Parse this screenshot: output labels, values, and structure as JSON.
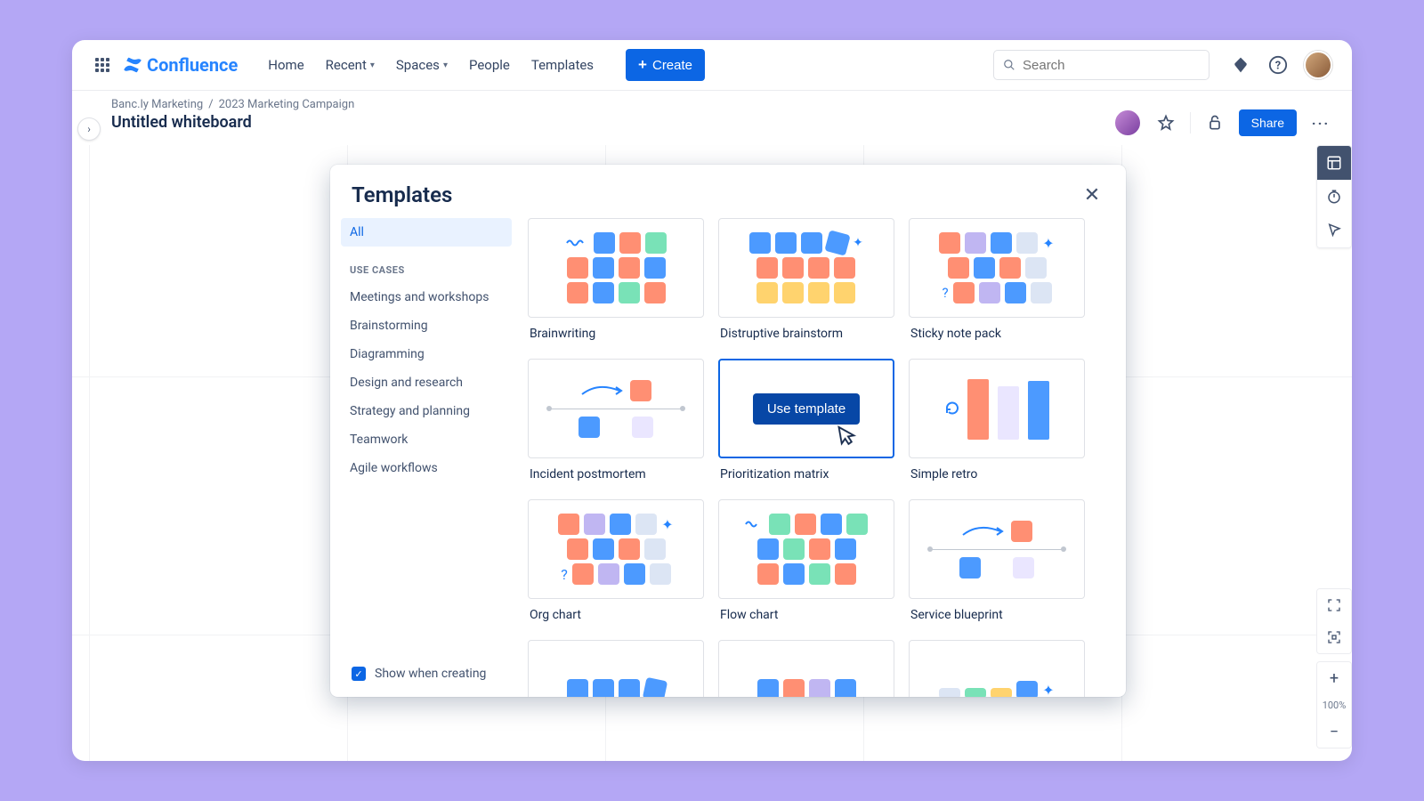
{
  "app": {
    "name": "Confluence"
  },
  "nav": {
    "home": "Home",
    "recent": "Recent",
    "spaces": "Spaces",
    "people": "People",
    "templates": "Templates",
    "create": "Create"
  },
  "search": {
    "placeholder": "Search"
  },
  "breadcrumb": {
    "space": "Banc.ly Marketing",
    "parent": "2023 Marketing Campaign"
  },
  "page": {
    "title": "Untitled whiteboard",
    "share": "Share"
  },
  "zoom": {
    "label": "100%"
  },
  "modal": {
    "title": "Templates",
    "sidebar": {
      "all": "All",
      "heading": "USE CASES",
      "items": [
        "Meetings and workshops",
        "Brainstorming",
        "Diagramming",
        "Design and research",
        "Strategy and planning",
        "Teamwork",
        "Agile workflows"
      ]
    },
    "show_when": "Show when creating",
    "use_template": "Use template",
    "templates": {
      "r0": [
        "Brainwriting",
        "Distruptive brainstorm",
        "Sticky note pack"
      ],
      "r1": [
        "Incident postmortem",
        "Prioritization matrix",
        "Simple retro"
      ],
      "r2": [
        "Org chart",
        "Flow chart",
        "Service blueprint"
      ]
    }
  }
}
